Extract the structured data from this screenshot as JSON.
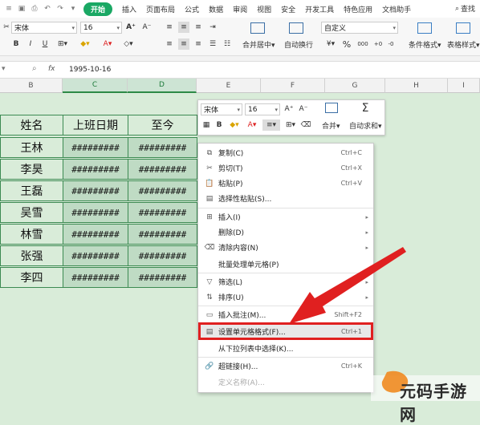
{
  "menubar": {
    "items": [
      "开始",
      "插入",
      "页面布局",
      "公式",
      "数据",
      "审阅",
      "视图",
      "安全",
      "开发工具",
      "特色应用",
      "文档助手"
    ],
    "active_index": 0,
    "search_label": "查找"
  },
  "ribbon": {
    "font_name": "宋体",
    "font_size": "16",
    "number_format": "自定义",
    "merge_label": "合并居中",
    "wrap_label": "自动换行",
    "cond_format_label": "条件格式",
    "table_style_label": "表格样式",
    "currency_symbol": "¥",
    "percent": "%",
    "thousands": "000"
  },
  "formula_bar": {
    "fx": "fx",
    "value": "1995-10-16"
  },
  "columns": [
    "B",
    "C",
    "D",
    "E",
    "F",
    "G",
    "H",
    "I"
  ],
  "table": {
    "headers": [
      "姓名",
      "上班日期",
      "至今"
    ],
    "rows": [
      [
        "王林",
        "#########",
        "#########"
      ],
      [
        "李昊",
        "#########",
        "#########"
      ],
      [
        "王磊",
        "#########",
        "#########"
      ],
      [
        "吴雪",
        "#########",
        "#########"
      ],
      [
        "林雪",
        "#########",
        "#########"
      ],
      [
        "张强",
        "#########",
        "#########"
      ],
      [
        "李四",
        "#########",
        "#########"
      ]
    ]
  },
  "mini_toolbar": {
    "font_name": "宋体",
    "font_size": "16",
    "merge_label": "合并",
    "autosum_label": "自动求和"
  },
  "context_menu": {
    "items": [
      {
        "label": "复制(C)",
        "shortcut": "Ctrl+C",
        "icon": "copy-icon"
      },
      {
        "label": "剪切(T)",
        "shortcut": "Ctrl+X",
        "icon": "scissors-icon"
      },
      {
        "label": "粘贴(P)",
        "shortcut": "Ctrl+V",
        "icon": "paste-icon"
      },
      {
        "label": "选择性粘贴(S)...",
        "shortcut": "",
        "icon": "paste-special-icon"
      },
      {
        "label": "插入(I)",
        "shortcut": "",
        "icon": "insert-icon",
        "submenu": true
      },
      {
        "label": "删除(D)",
        "shortcut": "",
        "icon": "",
        "submenu": true
      },
      {
        "label": "清除内容(N)",
        "shortcut": "",
        "icon": "eraser-icon",
        "submenu": true
      },
      {
        "label": "批量处理单元格(P)",
        "shortcut": "",
        "icon": ""
      },
      {
        "label": "筛选(L)",
        "shortcut": "",
        "icon": "filter-icon",
        "submenu": true
      },
      {
        "label": "排序(U)",
        "shortcut": "",
        "icon": "sort-icon",
        "submenu": true
      },
      {
        "label": "插入批注(M)...",
        "shortcut": "Shift+F2",
        "icon": "comment-icon"
      },
      {
        "label": "设置单元格格式(F)...",
        "shortcut": "Ctrl+1",
        "icon": "format-cells-icon"
      },
      {
        "label": "从下拉列表中选择(K)...",
        "shortcut": "",
        "icon": ""
      },
      {
        "label": "超链接(H)...",
        "shortcut": "Ctrl+K",
        "icon": "link-icon"
      },
      {
        "label": "定义名称(A)...",
        "shortcut": "",
        "icon": ""
      }
    ]
  },
  "watermark": {
    "text": "元码手游网"
  },
  "colors": {
    "accent": "#1aa864",
    "highlight_red": "#e02020",
    "sheet_bg": "#d9ecd9",
    "grid_line": "#3c8a52"
  }
}
